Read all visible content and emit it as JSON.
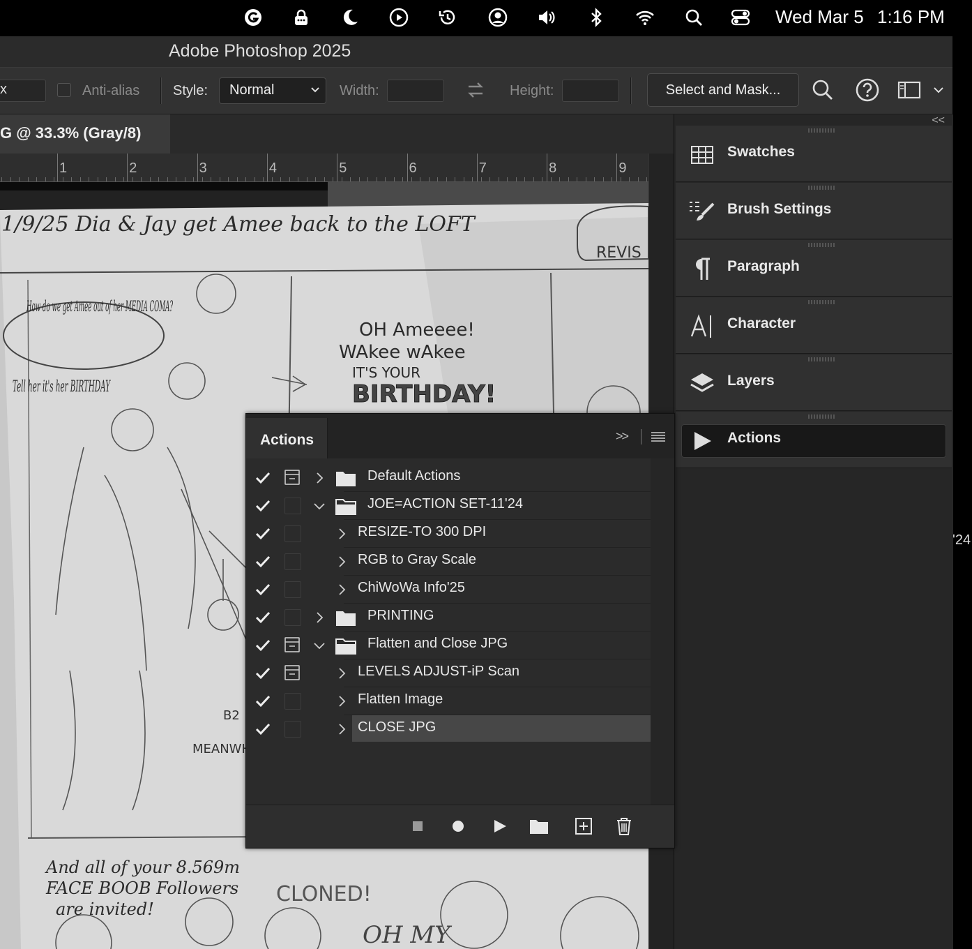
{
  "menubar": {
    "icons": [
      "grammarly-icon",
      "password-lock-icon",
      "moon-icon",
      "play-circle-icon",
      "time-machine-icon",
      "user-circle-icon",
      "volume-icon",
      "bluetooth-icon",
      "wifi-icon",
      "search-icon",
      "control-center-icon"
    ],
    "date": "Wed Mar 5",
    "time": "1:16 PM"
  },
  "window": {
    "title": "Adobe Photoshop 2025"
  },
  "options_bar": {
    "feather_value": "x",
    "antialias_label": "Anti-alias",
    "style_label": "Style:",
    "style_value": "Normal",
    "width_label": "Width:",
    "height_label": "Height:",
    "select_mask_label": "Select and Mask..."
  },
  "document": {
    "tab_label": "G @ 33.3% (Gray/8)",
    "ruler_numbers": [
      "1",
      "2",
      "3",
      "4",
      "5",
      "6",
      "7",
      "8",
      "9"
    ]
  },
  "artwork_text": {
    "header": "1/9/25 Dia & Jay get Amee back to the LOFT",
    "corner": "REVIS",
    "bubble1": "How do we get Amee out of her MEDIA COMA?",
    "bubble2": "Tell her it's her BIRTHDAY",
    "song1": "OH Ameeee!",
    "song2": "WAkee wAkee",
    "song3": "IT'S YOUR",
    "song4": "BIRTHDAY!",
    "sign": "B2",
    "meanwhile": "MEANWH",
    "footer1": "And all of your 8.569m",
    "footer2": "FACE BOOB Followers",
    "footer3": "are invited!",
    "cloned": "CLONED!",
    "ohmy": "OH MY"
  },
  "dock": {
    "collapse": "<<",
    "items": [
      {
        "label": "Swatches",
        "icon": "swatches-grid-icon"
      },
      {
        "label": "Brush Settings",
        "icon": "brush-settings-icon"
      },
      {
        "label": "Paragraph",
        "icon": "pilcrow-icon"
      },
      {
        "label": "Character",
        "icon": "character-icon"
      },
      {
        "label": "Layers",
        "icon": "layers-icon"
      },
      {
        "label": "Actions",
        "icon": "play-icon"
      }
    ]
  },
  "actions_panel": {
    "tab_label": "Actions",
    "expand": ">>",
    "rows": [
      {
        "name": "Default Actions",
        "kind": "set",
        "expanded": false,
        "dialog": true
      },
      {
        "name": "JOE=ACTION SET-11'24",
        "kind": "set",
        "expanded": true,
        "dialog": false
      },
      {
        "name": "RESIZE-TO 300 DPI",
        "kind": "action",
        "expanded": false,
        "dialog": false
      },
      {
        "name": "RGB to Gray Scale",
        "kind": "action",
        "expanded": false,
        "dialog": false
      },
      {
        "name": "ChiWoWa Info'25",
        "kind": "action",
        "expanded": false,
        "dialog": false
      },
      {
        "name": "PRINTING",
        "kind": "set",
        "expanded": false,
        "dialog": false
      },
      {
        "name": "Flatten and Close JPG",
        "kind": "set",
        "expanded": true,
        "dialog": true
      },
      {
        "name": "LEVELS ADJUST-iP Scan",
        "kind": "action",
        "expanded": false,
        "dialog": true
      },
      {
        "name": "Flatten Image",
        "kind": "action",
        "expanded": false,
        "dialog": false
      },
      {
        "name": "CLOSE JPG",
        "kind": "action",
        "expanded": false,
        "dialog": false,
        "selected": true
      }
    ],
    "footer_icons": [
      "stop-icon",
      "record-icon",
      "play-icon",
      "new-set-folder-icon",
      "new-action-icon",
      "trash-icon"
    ]
  },
  "edge_text": "'24"
}
